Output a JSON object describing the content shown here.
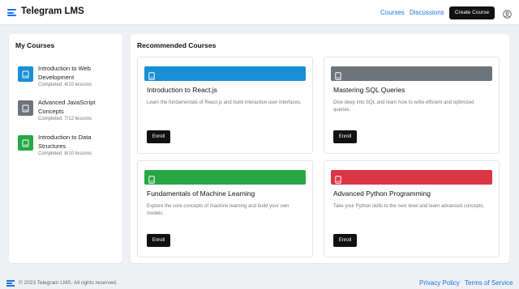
{
  "header": {
    "title": "Telegram LMS",
    "nav": {
      "courses": "Courses",
      "discussions": "Discussions"
    },
    "create_button": "Create Course",
    "menu_icon": "menu-icon",
    "avatar_icon": "user-icon"
  },
  "sidebar": {
    "title": "My Courses",
    "items": [
      {
        "name": "Introduction to Web Development",
        "progress": "Completed: 4/10 lessons",
        "color": "#1a8fd6",
        "icon": "book-icon"
      },
      {
        "name": "Advanced JavaScript Concepts",
        "progress": "Completed: 7/12 lessons",
        "color": "#6c757d",
        "icon": "book-icon"
      },
      {
        "name": "Introduction to Data Structures",
        "progress": "Completed: 8/10 lessons",
        "color": "#28a745",
        "icon": "book-icon"
      }
    ]
  },
  "main": {
    "title": "Recommended Courses",
    "cards": [
      {
        "title": "Introduction to React.js",
        "description": "Learn the fundamentals of React.js and build interactive user interfaces.",
        "button": "Enroll",
        "color": "#1a8fd6"
      },
      {
        "title": "Mastering SQL Queries",
        "description": "Dive deep into SQL and learn how to write efficient and optimized queries.",
        "button": "Enroll",
        "color": "#6c757d"
      },
      {
        "title": "Fundamentals of Machine Learning",
        "description": "Explore the core concepts of machine learning and build your own models.",
        "button": "Enroll",
        "color": "#28a745"
      },
      {
        "title": "Advanced Python Programming",
        "description": "Take your Python skills to the next level and learn advanced concepts.",
        "button": "Enroll",
        "color": "#dc3545"
      }
    ]
  },
  "footer": {
    "copyright": "© 2023 Telegram LMS. All rights reserved.",
    "privacy": "Privacy Policy",
    "terms": "Terms of Service"
  }
}
